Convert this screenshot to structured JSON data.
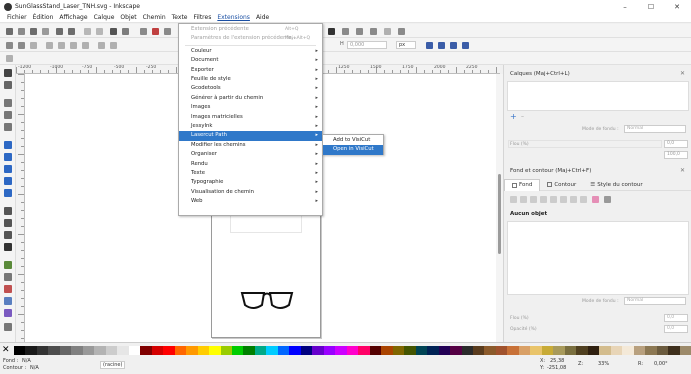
{
  "window": {
    "title": "SunGlassStand_Laser_TNH.svg - Inkscape",
    "minimize_glyph": "–",
    "maximize_glyph": "☐",
    "close_glyph": "✕"
  },
  "menubar": {
    "items": [
      "Fichier",
      "Édition",
      "Affichage",
      "Calque",
      "Objet",
      "Chemin",
      "Texte",
      "Filtres",
      "Extensions",
      "Aide"
    ],
    "active": "Extensions"
  },
  "toolbar": {
    "unit_select": "px",
    "h_label": "H",
    "h_value": "0,000"
  },
  "extensions_menu": {
    "items": [
      {
        "label": "Extension précédente",
        "shortcut": "Alt+Q",
        "disabled": true,
        "submenu": false
      },
      {
        "label": "Paramètres de l'extension précédente...",
        "shortcut": "Maj+Alt+Q",
        "disabled": true,
        "submenu": false
      },
      {
        "label": "Couleur",
        "shortcut": "",
        "disabled": false,
        "submenu": true
      },
      {
        "label": "Document",
        "shortcut": "",
        "disabled": false,
        "submenu": true
      },
      {
        "label": "Exporter",
        "shortcut": "",
        "disabled": false,
        "submenu": true
      },
      {
        "label": "Feuille de style",
        "shortcut": "",
        "disabled": false,
        "submenu": true
      },
      {
        "label": "Gcodetools",
        "shortcut": "",
        "disabled": false,
        "submenu": true
      },
      {
        "label": "Générer à partir du chemin",
        "shortcut": "",
        "disabled": false,
        "submenu": true
      },
      {
        "label": "Images",
        "shortcut": "",
        "disabled": false,
        "submenu": true
      },
      {
        "label": "Images matricielles",
        "shortcut": "",
        "disabled": false,
        "submenu": true
      },
      {
        "label": "JessyInk",
        "shortcut": "",
        "disabled": false,
        "submenu": true
      },
      {
        "label": "Lasercut Path",
        "shortcut": "",
        "disabled": false,
        "submenu": true,
        "highlighted": true
      },
      {
        "label": "Modifier les chemins",
        "shortcut": "",
        "disabled": false,
        "submenu": true
      },
      {
        "label": "Organiser",
        "shortcut": "",
        "disabled": false,
        "submenu": true
      },
      {
        "label": "Rendu",
        "shortcut": "",
        "disabled": false,
        "submenu": true
      },
      {
        "label": "Texte",
        "shortcut": "",
        "disabled": false,
        "submenu": true
      },
      {
        "label": "Typographie",
        "shortcut": "",
        "disabled": false,
        "submenu": true
      },
      {
        "label": "Visualisation de chemin",
        "shortcut": "",
        "disabled": false,
        "submenu": true
      },
      {
        "label": "Web",
        "shortcut": "",
        "disabled": false,
        "submenu": true
      }
    ]
  },
  "submenu": {
    "items": [
      {
        "label": "Add to VisiCut",
        "highlighted": false
      },
      {
        "label": "Open in VisiCut",
        "highlighted": true
      }
    ]
  },
  "dock": {
    "layers_header": "Calques (Maj+Ctrl+L)",
    "blend_label": "Mode de fondu :",
    "blend_value": "Normal",
    "blur_label": "Flou (%)",
    "blur_value": "0,0",
    "opacity_value": "100,0",
    "fill_stroke_header": "Fond et contour (Maj+Ctrl+F)",
    "tabs": [
      "Fond",
      "Contour",
      "Style du contour"
    ],
    "no_object": "Aucun objet",
    "blend_label_2": "Mode de fondu :",
    "blend_value_2": "Normal",
    "blur_label_2": "Flou (%)",
    "blur_value_2": "0,0",
    "opacity_label_2": "Opacité (%)",
    "opacity_value_2": "0,0"
  },
  "ruler": {
    "labels": [
      "-1200",
      "-1000",
      "-750",
      "-500",
      "-250",
      "0",
      "250",
      "500",
      "750",
      "1000",
      "1250",
      "1500",
      "1750",
      "2000",
      "2250"
    ]
  },
  "status": {
    "fill_label": "Fond :",
    "fill_value": "N/A",
    "stroke_label": "Contour :",
    "stroke_value": "N/A",
    "layer": "(racine)",
    "x_label": "X:",
    "x_value": "25,38",
    "y_label": "Y:",
    "y_value": "-251,08",
    "z_label": "Z:",
    "zoom": "33%",
    "r_label": "R:",
    "rotation": "0,00°"
  },
  "palette_colors": [
    "#000000",
    "#1a1a1a",
    "#333333",
    "#4d4d4d",
    "#666666",
    "#808080",
    "#999999",
    "#b3b3b3",
    "#cccccc",
    "#e6e6e6",
    "#ffffff",
    "#800000",
    "#d40000",
    "#ff0000",
    "#ff6600",
    "#ff9900",
    "#ffcc00",
    "#ffff00",
    "#99cc00",
    "#00cc00",
    "#008000",
    "#00aa88",
    "#00ccff",
    "#0066ff",
    "#0000ff",
    "#000080",
    "#6600cc",
    "#9900ff",
    "#cc00ff",
    "#ff00cc",
    "#ff0066",
    "#550000",
    "#aa4400",
    "#806600",
    "#445500",
    "#004455",
    "#002255",
    "#220055",
    "#550044",
    "#2b2b2b",
    "#5a3c1e",
    "#8b5a2b",
    "#a0522d",
    "#c87137",
    "#d9a066",
    "#e9c46a",
    "#c8ab37",
    "#a89a5b",
    "#7a6f3f",
    "#504020",
    "#302010",
    "#d3bc8d",
    "#e8d5b7",
    "#f4e9d8",
    "#b8a07e",
    "#8c7853",
    "#6b5b3e",
    "#3e2f1c",
    "#9c8a6a"
  ]
}
